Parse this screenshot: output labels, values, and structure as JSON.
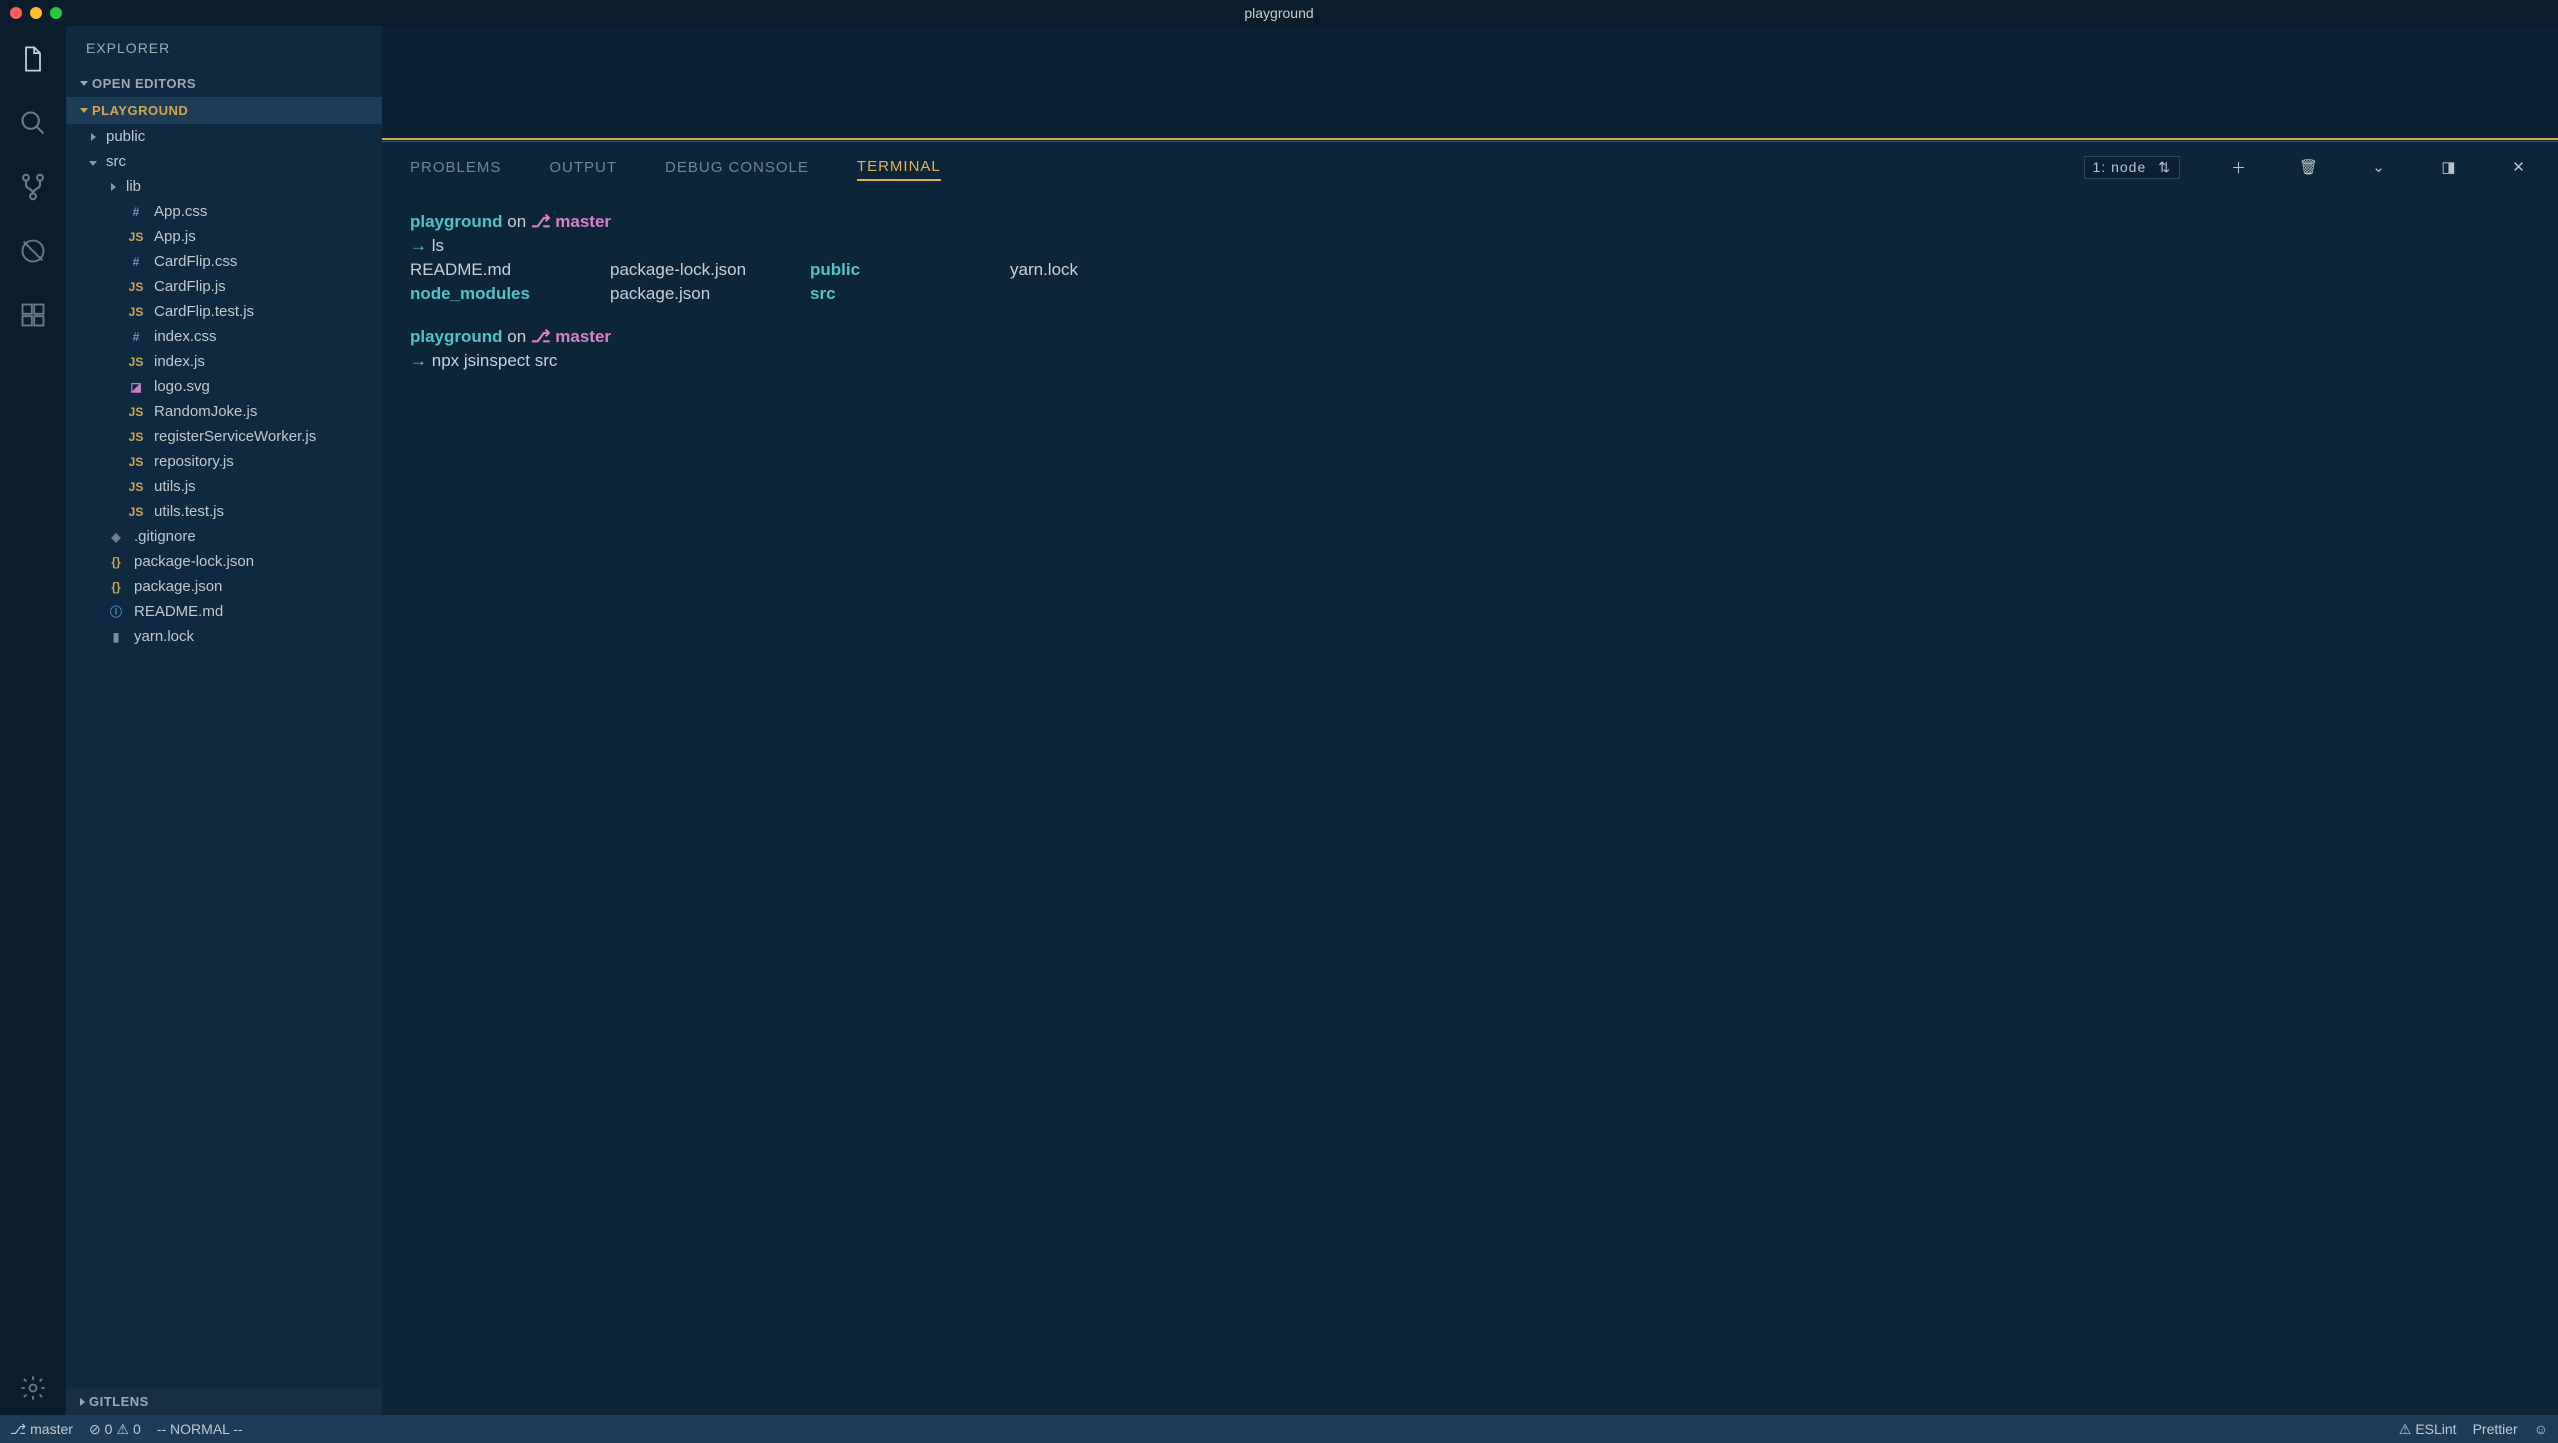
{
  "window": {
    "title": "playground"
  },
  "traffic": {
    "close": "#ff5f57",
    "min": "#febc2e",
    "max": "#28c840"
  },
  "activity": {
    "items": [
      {
        "name": "explorer-icon"
      },
      {
        "name": "search-icon"
      },
      {
        "name": "source-control-icon"
      },
      {
        "name": "debug-icon"
      },
      {
        "name": "extensions-icon"
      }
    ],
    "settings": "gear-icon"
  },
  "sidebar": {
    "title": "EXPLORER",
    "sections": {
      "openEditors": "OPEN EDITORS",
      "workspace": "PLAYGROUND",
      "gitlens": "GITLENS"
    },
    "tree": [
      {
        "type": "folder",
        "name": "public",
        "depth": 0,
        "expanded": false
      },
      {
        "type": "folder",
        "name": "src",
        "depth": 0,
        "expanded": true
      },
      {
        "type": "folder",
        "name": "lib",
        "depth": 1,
        "expanded": false
      },
      {
        "type": "file",
        "name": "App.css",
        "icon": "hash",
        "iconTxt": "#",
        "depth": 1
      },
      {
        "type": "file",
        "name": "App.js",
        "icon": "js",
        "iconTxt": "JS",
        "depth": 1
      },
      {
        "type": "file",
        "name": "CardFlip.css",
        "icon": "hash",
        "iconTxt": "#",
        "depth": 1
      },
      {
        "type": "file",
        "name": "CardFlip.js",
        "icon": "js",
        "iconTxt": "JS",
        "depth": 1
      },
      {
        "type": "file",
        "name": "CardFlip.test.js",
        "icon": "js",
        "iconTxt": "JS",
        "depth": 1
      },
      {
        "type": "file",
        "name": "index.css",
        "icon": "hash",
        "iconTxt": "#",
        "depth": 1
      },
      {
        "type": "file",
        "name": "index.js",
        "icon": "js",
        "iconTxt": "JS",
        "depth": 1
      },
      {
        "type": "file",
        "name": "logo.svg",
        "icon": "svg",
        "iconTxt": "◪",
        "depth": 1
      },
      {
        "type": "file",
        "name": "RandomJoke.js",
        "icon": "js",
        "iconTxt": "JS",
        "depth": 1
      },
      {
        "type": "file",
        "name": "registerServiceWorker.js",
        "icon": "js",
        "iconTxt": "JS",
        "depth": 1
      },
      {
        "type": "file",
        "name": "repository.js",
        "icon": "js",
        "iconTxt": "JS",
        "depth": 1
      },
      {
        "type": "file",
        "name": "utils.js",
        "icon": "js",
        "iconTxt": "JS",
        "depth": 1
      },
      {
        "type": "file",
        "name": "utils.test.js",
        "icon": "js",
        "iconTxt": "JS",
        "depth": 1
      },
      {
        "type": "file",
        "name": ".gitignore",
        "icon": "git",
        "iconTxt": "◈",
        "depth": 0
      },
      {
        "type": "file",
        "name": "package-lock.json",
        "icon": "brace",
        "iconTxt": "{}",
        "depth": 0
      },
      {
        "type": "file",
        "name": "package.json",
        "icon": "brace",
        "iconTxt": "{}",
        "depth": 0
      },
      {
        "type": "file",
        "name": "README.md",
        "icon": "info",
        "iconTxt": "ⓘ",
        "depth": 0
      },
      {
        "type": "file",
        "name": "yarn.lock",
        "icon": "lock",
        "iconTxt": "▮",
        "depth": 0
      }
    ]
  },
  "panel": {
    "tabs": {
      "problems": "PROBLEMS",
      "output": "OUTPUT",
      "debug": "DEBUG CONSOLE",
      "terminal": "TERMINAL"
    },
    "shell": "1: node",
    "terminal": {
      "prompt1": {
        "dir": "playground",
        "on": "on",
        "branch": "master"
      },
      "cmd1": "ls",
      "ls": {
        "c1a": "README.md",
        "c1b": "node_modules",
        "c2a": "package-lock.json",
        "c2b": "package.json",
        "c3a": "public",
        "c3b": "src",
        "c4a": "yarn.lock"
      },
      "prompt2": {
        "dir": "playground",
        "on": "on",
        "branch": "master"
      },
      "cmd2": "npx jsinspect src"
    }
  },
  "status": {
    "branch": "master",
    "errors": "0",
    "warnings": "0",
    "mode": "-- NORMAL --",
    "eslint": "ESLint",
    "prettier": "Prettier"
  }
}
